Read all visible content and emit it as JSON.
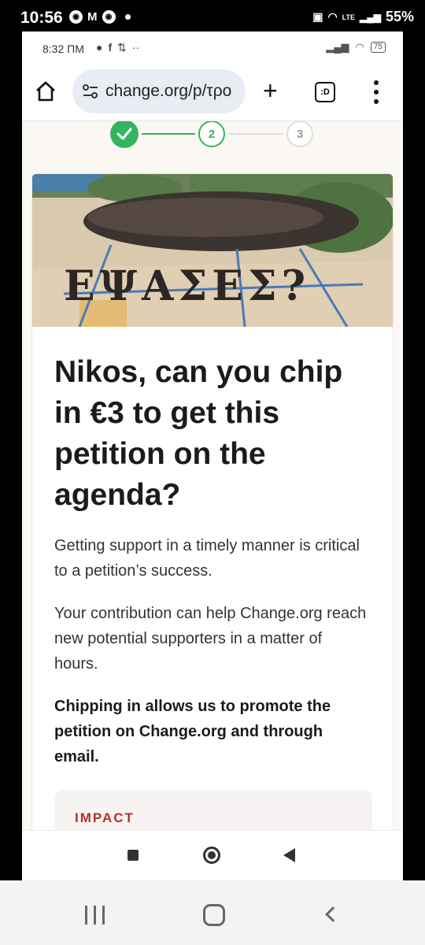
{
  "outer_status": {
    "time": "10:56",
    "battery": "55%",
    "network": "LTE"
  },
  "inner_status": {
    "time": "8:32 ΠΜ",
    "battery": "75"
  },
  "browser": {
    "url": "change.org/p/τρο",
    "tabs_label": ":D"
  },
  "stepper": {
    "steps": [
      "2",
      "3"
    ]
  },
  "photo": {
    "text": "ΕΨΑΣΕΣ?"
  },
  "article": {
    "headline": "Nikos, can you chip in €3 to get this petition on the agenda?",
    "para1": "Getting support in a timely manner is critical to a petition’s success.",
    "para2": "Your contribution can help Change.org reach new potential supporters in a matter of hours.",
    "para3": "Chipping in allows us to promote the petition on Change.org and through email."
  },
  "impact": {
    "label": "IMPACT"
  },
  "colors": {
    "accent_green": "#34b45e",
    "impact_red": "#b3302a",
    "page_bg": "#fbf8f3"
  }
}
